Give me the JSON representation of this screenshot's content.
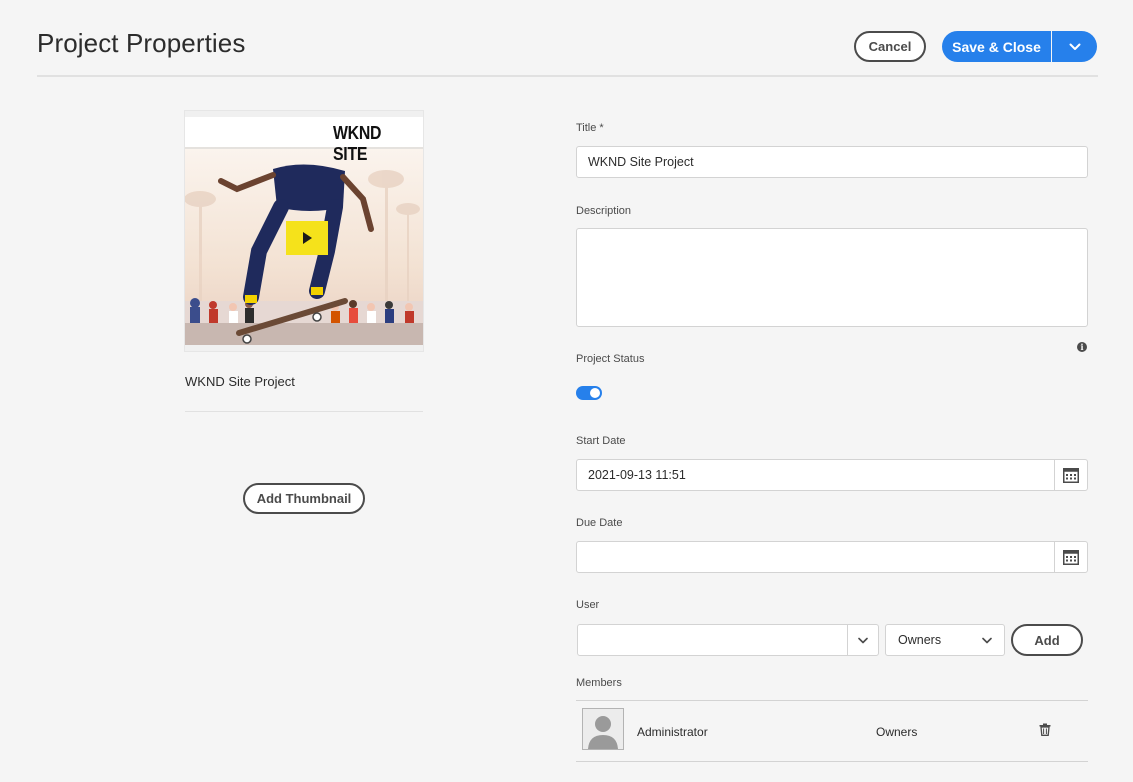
{
  "header": {
    "title": "Project Properties",
    "cancel_label": "Cancel",
    "save_label": "Save & Close",
    "accent_color": "#2680eb"
  },
  "thumbnail": {
    "brand_text": "WKND SITE",
    "caption": "WKND Site Project",
    "add_label": "Add Thumbnail",
    "play_icon": "play-icon"
  },
  "form": {
    "title_label": "Title *",
    "title_value": "WKND Site Project",
    "description_label": "Description",
    "description_value": "",
    "status_label": "Project Status",
    "status_on": true,
    "start_label": "Start Date",
    "start_value": "2021-09-13 11:51",
    "due_label": "Due Date",
    "due_value": "",
    "user_label": "User",
    "user_value": "",
    "role_selected": "Owners",
    "add_label": "Add",
    "members_label": "Members",
    "members": [
      {
        "name": "Administrator",
        "role": "Owners"
      }
    ]
  }
}
